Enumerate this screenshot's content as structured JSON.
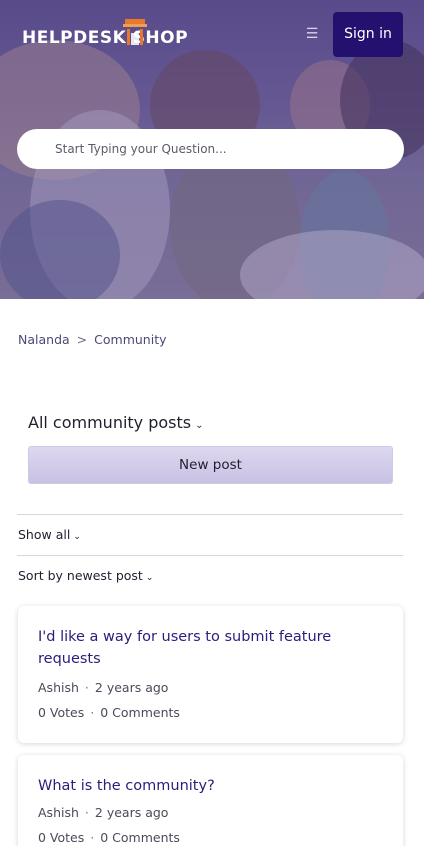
{
  "header": {
    "logo_text": "HELPDESK SHOP",
    "menu_icon": "hamburger-menu-icon",
    "signin_label": "Sign in"
  },
  "search": {
    "placeholder": "Start Typing your Question..."
  },
  "breadcrumb": {
    "items": [
      "Nalanda",
      "Community"
    ],
    "separator": ">"
  },
  "posts": {
    "title": "All community posts",
    "new_post_label": "New post",
    "filter_label": "Show all",
    "sort_label": "Sort by newest post",
    "items": [
      {
        "title": "I'd like a way for users to submit feature requests",
        "author": "Ashish",
        "time": "2 years ago",
        "votes": "0 Votes",
        "comments": "0 Comments"
      },
      {
        "title": "What is the community?",
        "author": "Ashish",
        "time": "2 years ago",
        "votes": "0 Votes",
        "comments": "0 Comments"
      }
    ]
  },
  "colors": {
    "brand": "#24106e",
    "link": "#2b1d7a",
    "logo_accent": "#e8782a"
  }
}
